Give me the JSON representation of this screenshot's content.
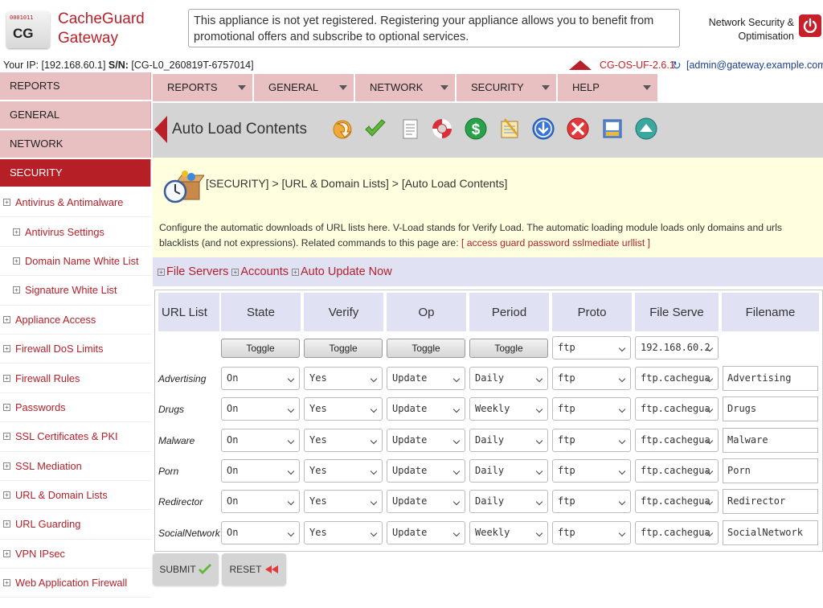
{
  "header": {
    "logo_text": "CG",
    "logo_bits": "0001011",
    "brand_line1": "CacheGuard",
    "brand_line2": "Gateway",
    "notice": "This appliance is not yet registered. Registering your appliance allows you to benefit from promotional offers and subscribe to optional services.",
    "tagline_line1": "Network Security &",
    "tagline_line2": "Optimisation"
  },
  "infobar": {
    "ip_label": "Your IP:",
    "ip_value": "[192.168.60.1]",
    "sn_label": "S/N:",
    "sn_value": "[CG-L0_260819T-6757014]",
    "version": "CG-OS-UF-2.6.1",
    "user": "[admin@gateway.example.com]"
  },
  "sidebar": {
    "main": [
      "REPORTS",
      "GENERAL",
      "NETWORK",
      "SECURITY"
    ],
    "items": [
      {
        "label": "Antivirus & Antimalware",
        "level": 1
      },
      {
        "label": "Antivirus Settings",
        "level": 2
      },
      {
        "label": "Domain Name White List",
        "level": 2
      },
      {
        "label": "Signature White List",
        "level": 2
      },
      {
        "label": "Appliance Access",
        "level": 1
      },
      {
        "label": "Firewall DoS Limits",
        "level": 1
      },
      {
        "label": "Firewall Rules",
        "level": 1
      },
      {
        "label": "Passwords",
        "level": 1
      },
      {
        "label": "SSL Certificates & PKI",
        "level": 1
      },
      {
        "label": "SSL Mediation",
        "level": 1
      },
      {
        "label": "URL & Domain Lists",
        "level": 1
      },
      {
        "label": "URL Guarding",
        "level": 1
      },
      {
        "label": "VPN IPsec",
        "level": 1
      },
      {
        "label": "Web Application Firewall",
        "level": 1
      }
    ]
  },
  "topnav": [
    "REPORTS",
    "GENERAL",
    "NETWORK",
    "SECURITY",
    "HELP"
  ],
  "title": "Auto Load Contents",
  "toolbar_icons": [
    "import-icon",
    "apply-checkmark-icon",
    "document-icon",
    "help-lifebuoy-icon",
    "license-dollar-icon",
    "notes-icon",
    "download-icon",
    "cancel-icon",
    "archive-icon",
    "upload-cloud-icon"
  ],
  "breadcrumb": {
    "a": "[SECURITY]",
    "b": "[URL & Domain Lists]",
    "c": "[Auto Load Contents]",
    "sep": ">"
  },
  "description": {
    "text": "Configure the automatic downloads of URL lists here. V-Load stands for Verify Load. The automatic loading module loads only domains and urls blacklists (and not expressions). Related commands to this page are: ",
    "cmd_open": "[ ",
    "cmd": "access guard password sslmediate urllist",
    "cmd_close": " ]"
  },
  "links": [
    "File Servers",
    "Accounts",
    "Auto Update Now"
  ],
  "table": {
    "headers": [
      "URL List",
      "State",
      "Verify",
      "Op",
      "Period",
      "Proto",
      "File Serve",
      "Filename"
    ],
    "toggle_label": "Toggle",
    "top_proto": "ftp",
    "top_server": "192.168.60.2",
    "rows": [
      {
        "name": "Advertising",
        "state": "On",
        "verify": "Yes",
        "op": "Update",
        "period": "Daily",
        "proto": "ftp",
        "server": "ftp.cachegua",
        "file": "Advertising"
      },
      {
        "name": "Drugs",
        "state": "On",
        "verify": "Yes",
        "op": "Update",
        "period": "Weekly",
        "proto": "ftp",
        "server": "ftp.cachegua",
        "file": "Drugs"
      },
      {
        "name": "Malware",
        "state": "On",
        "verify": "Yes",
        "op": "Update",
        "period": "Daily",
        "proto": "ftp",
        "server": "ftp.cachegua",
        "file": "Malware"
      },
      {
        "name": "Porn",
        "state": "On",
        "verify": "Yes",
        "op": "Update",
        "period": "Daily",
        "proto": "ftp",
        "server": "ftp.cachegua",
        "file": "Porn"
      },
      {
        "name": "Redirector",
        "state": "On",
        "verify": "Yes",
        "op": "Update",
        "period": "Daily",
        "proto": "ftp",
        "server": "ftp.cachegua",
        "file": "Redirector"
      },
      {
        "name": "SocialNetwork",
        "state": "On",
        "verify": "Yes",
        "op": "Update",
        "period": "Weekly",
        "proto": "ftp",
        "server": "ftp.cachegua",
        "file": "SocialNetwork"
      }
    ]
  },
  "buttons": {
    "submit": "SUBMIT",
    "reset": "RESET"
  },
  "colors": {
    "accent": "#b8202a",
    "nav_bg": "#e8c0c2",
    "header_bg": "#e1e1f4",
    "info_bg": "#ffffe0"
  }
}
